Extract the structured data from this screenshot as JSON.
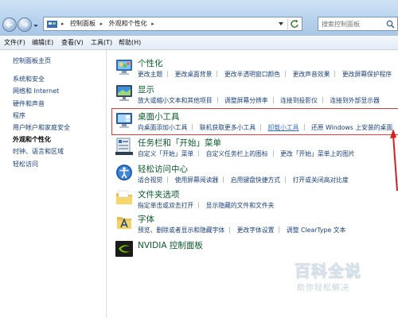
{
  "address": {
    "crumbs": [
      "控制面板",
      "外观和个性化"
    ],
    "separator": "▸"
  },
  "search": {
    "placeholder": "搜索控制面板"
  },
  "menu": [
    "文件(F)",
    "编辑(E)",
    "查看(V)",
    "工具(T)",
    "帮助(H)"
  ],
  "left": {
    "home": "控制面板主页",
    "links": [
      "系统和安全",
      "网络和 Internet",
      "硬件和声音",
      "程序",
      "用户帐户和家庭安全",
      "外观和个性化",
      "时钟、语言和区域",
      "轻松访问"
    ],
    "active_index": 5
  },
  "categories": [
    {
      "title": "个性化",
      "links": [
        "更改主题",
        "更改桌面背景",
        "更改半透明窗口颜色",
        "更改声音效果",
        "更改屏幕保护程序"
      ],
      "icon": "personalization-icon"
    },
    {
      "title": "显示",
      "links": [
        "放大或缩小文本和其他项目",
        "调整屏幕分辨率",
        "连接到投影仪",
        "连接到外部显示器"
      ],
      "icon": "display-icon"
    },
    {
      "title": "桌面小工具",
      "links": [
        "向桌面添加小工具",
        "联机获取更多小工具",
        "卸载小工具",
        "还原 Windows 上安装的桌面"
      ],
      "icon": "gadgets-icon"
    },
    {
      "title": "任务栏和「开始」菜单",
      "links": [
        "自定义「开始」菜单",
        "自定义任务栏上的图标",
        "更改「开始」菜单上的图片"
      ],
      "icon": "taskbar-icon"
    },
    {
      "title": "轻松访问中心",
      "links": [
        "适合视觉",
        "使用屏幕阅读器",
        "启用键盘快捷方式",
        "打开或关闭高对比度"
      ],
      "icon": "ease-of-access-icon"
    },
    {
      "title": "文件夹选项",
      "links": [
        "指定单击或双击打开",
        "显示隐藏的文件和文件夹"
      ],
      "icon": "folder-options-icon"
    },
    {
      "title": "字体",
      "links": [
        "预览、删除或者显示和隐藏字体",
        "更改字体设置",
        "调整 ClearType 文本"
      ],
      "icon": "fonts-icon"
    },
    {
      "title": "NVIDIA 控制面板",
      "links": [],
      "icon": "nvidia-icon"
    }
  ],
  "watermark": {
    "big": "百科全说",
    "small": "助你轻松解决"
  },
  "colors": {
    "accent_link": "#1a3f7a",
    "category_title": "#0a5a2b",
    "highlight": "#e23b3b"
  }
}
